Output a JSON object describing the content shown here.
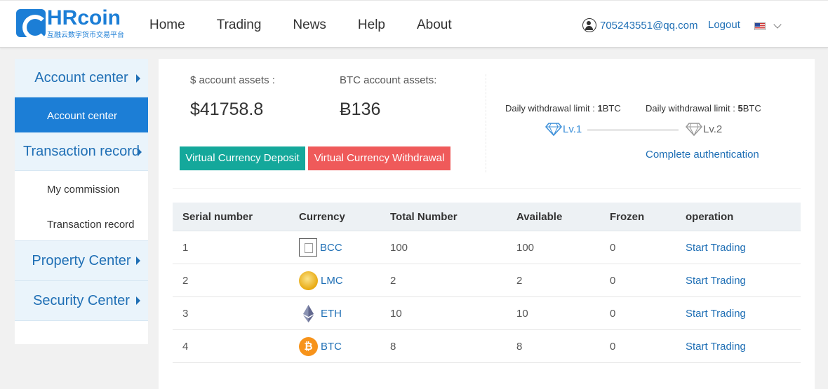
{
  "header": {
    "logo_text": "HRcoin",
    "logo_sub": "互融云数字货币交易平台",
    "nav": [
      "Home",
      "Trading",
      "News",
      "Help",
      "About"
    ],
    "user_email": "705243551@qq.com",
    "logout": "Logout"
  },
  "sidebar": {
    "groups": [
      {
        "label": "Account center",
        "items": [
          "Account center"
        ]
      },
      {
        "label": "Transaction record",
        "items": [
          "My commission",
          "Transaction record"
        ]
      },
      {
        "label": "Property Center"
      },
      {
        "label": "Security Center"
      }
    ]
  },
  "assets": {
    "usd_label": "$ account assets :",
    "usd_value": "$41758.8",
    "btc_label": "BTC account assets:",
    "btc_value": "Ƀ136",
    "deposit_button": "Virtual Currency Deposit",
    "withdraw_button": "Virtual Currency Withdrawal"
  },
  "levels": {
    "lv1_limit_prefix": "Daily withdrawal limit :",
    "lv1_limit_amount": "1",
    "lv1_limit_unit": "BTC",
    "lv2_limit_prefix": "Daily withdrawal limit :",
    "lv2_limit_amount": "5",
    "lv2_limit_unit": "BTC",
    "lv1_label": "Lv.1",
    "lv2_label": "Lv.2",
    "auth_link": "Complete authentication",
    "colors": {
      "lv1": "#3b8fd9",
      "lv2": "#999999"
    }
  },
  "table": {
    "headers": [
      "Serial number",
      "Currency",
      "Total Number",
      "Available",
      "Frozen",
      "operation"
    ],
    "rows": [
      {
        "serial": "1",
        "currency": "BCC",
        "icon": "bcc-icon",
        "total": "100",
        "available": "100",
        "frozen": "0",
        "action": "Start Trading"
      },
      {
        "serial": "2",
        "currency": "LMC",
        "icon": "lmc-icon",
        "total": "2",
        "available": "2",
        "frozen": "0",
        "action": "Start Trading"
      },
      {
        "serial": "3",
        "currency": "ETH",
        "icon": "eth-icon",
        "total": "10",
        "available": "10",
        "frozen": "0",
        "action": "Start Trading"
      },
      {
        "serial": "4",
        "currency": "BTC",
        "icon": "btc-icon",
        "total": "8",
        "available": "8",
        "frozen": "0",
        "action": "Start Trading"
      }
    ]
  },
  "colors": {
    "brand": "#1c7ed6",
    "deposit": "#14a89b",
    "withdraw": "#ef5a5a",
    "link": "#1f6fb5"
  }
}
